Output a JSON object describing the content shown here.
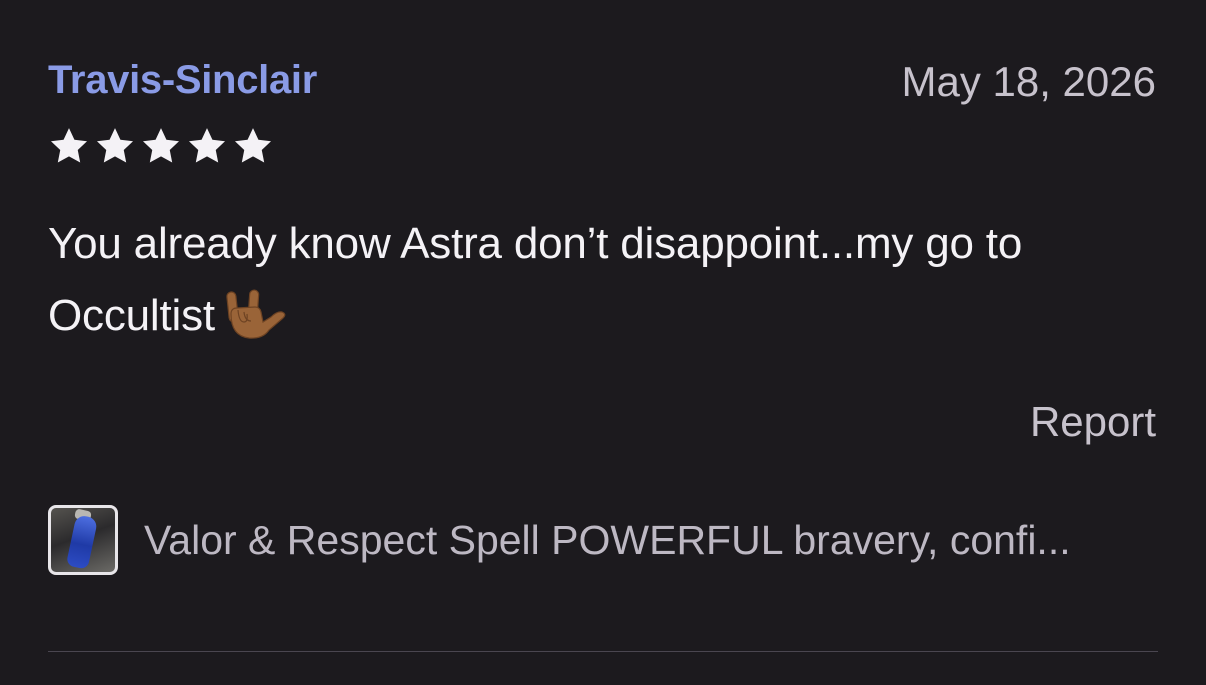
{
  "review": {
    "reviewer_name": "Travis-Sinclair",
    "date": "May 18, 2026",
    "rating": 5,
    "rating_max": 5,
    "text": "You already know Astra don’t disappoint...my go to Occultist",
    "emoji_icon": "love-you-hand-gesture-icon",
    "report_label": "Report"
  },
  "listing": {
    "title": "Valor & Respect Spell POWERFUL bravery, confi...",
    "thumbnail_icon": "blue-crystal-pendant-thumbnail"
  },
  "colors": {
    "background": "#1c1a1e",
    "reviewer_name": "#8a9be6",
    "muted_text": "#c7c2cc",
    "body_text": "#f4f2f6",
    "star": "#f4f2f6"
  }
}
